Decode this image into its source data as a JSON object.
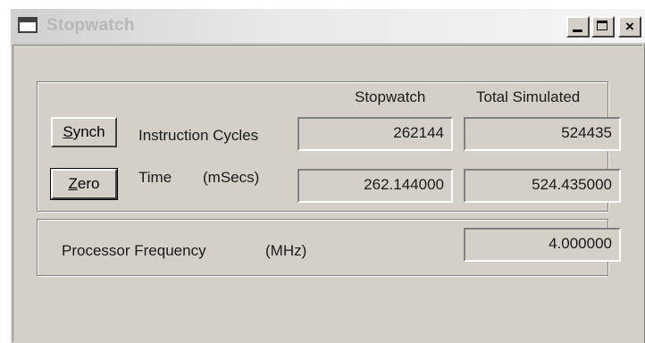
{
  "window": {
    "title": "Stopwatch",
    "icon": "app-window-icon",
    "controls": {
      "minimize": "minimize-icon",
      "maximize": "maximize-icon",
      "close": "×"
    }
  },
  "columns": {
    "stopwatch": "Stopwatch",
    "total_simulated": "Total Simulated"
  },
  "rows": {
    "instruction_cycles": {
      "button_label_underlined": "S",
      "button_label_rest": "ynch",
      "label": "Instruction Cycles",
      "stopwatch_value": "262144",
      "total_value": "524435"
    },
    "time": {
      "button_label_underlined": "Z",
      "button_label_rest": "ero",
      "label": "Time",
      "unit": "(mSecs)",
      "stopwatch_value": "262.144000",
      "total_value": "524.435000"
    }
  },
  "processor": {
    "label": "Processor Frequency",
    "unit": "(MHz)",
    "value": "4.000000"
  },
  "colors": {
    "face": "#d4d0c8",
    "shadow": "#808080",
    "highlight": "#ffffff"
  }
}
